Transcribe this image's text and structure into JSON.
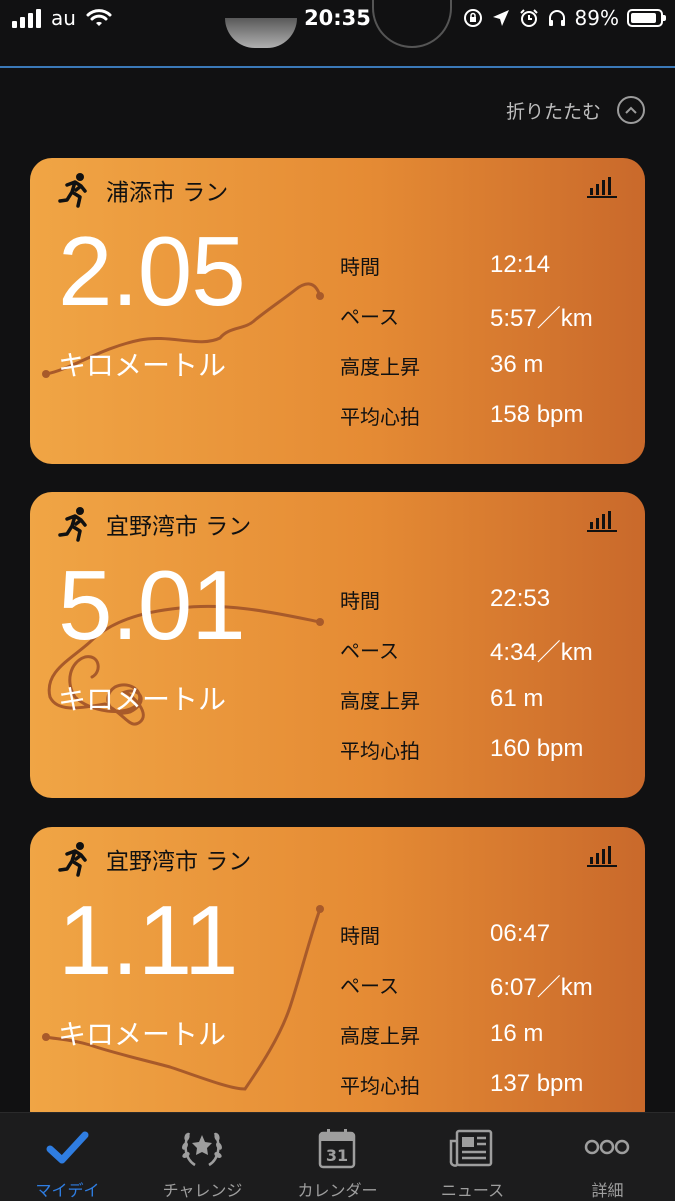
{
  "status_bar": {
    "carrier": "au",
    "time": "20:35",
    "battery_percent": "89%",
    "battery_level": 0.89
  },
  "collapse": {
    "label": "折りたたむ"
  },
  "activities": [
    {
      "title": "浦添市 ラン",
      "distance": "2.05",
      "unit": "キロメートル",
      "metrics": [
        {
          "label": "時間",
          "value": "12:14"
        },
        {
          "label": "ペース",
          "value": "5:57／km"
        },
        {
          "label": "高度上昇",
          "value": "36 m"
        },
        {
          "label": "平均心拍",
          "value": "158 bpm"
        }
      ]
    },
    {
      "title": "宜野湾市 ラン",
      "distance": "5.01",
      "unit": "キロメートル",
      "metrics": [
        {
          "label": "時間",
          "value": "22:53"
        },
        {
          "label": "ペース",
          "value": "4:34／km"
        },
        {
          "label": "高度上昇",
          "value": "61 m"
        },
        {
          "label": "平均心拍",
          "value": "160 bpm"
        }
      ]
    },
    {
      "title": "宜野湾市 ラン",
      "distance": "1.11",
      "unit": "キロメートル",
      "metrics": [
        {
          "label": "時間",
          "value": "06:47"
        },
        {
          "label": "ペース",
          "value": "6:07／km"
        },
        {
          "label": "高度上昇",
          "value": "16 m"
        },
        {
          "label": "平均心拍",
          "value": "137 bpm"
        }
      ]
    }
  ],
  "tabs": [
    {
      "label": "マイデイ",
      "icon": "checkmark-icon",
      "active": true
    },
    {
      "label": "チャレンジ",
      "icon": "laurel-icon",
      "active": false
    },
    {
      "label": "カレンダー",
      "icon": "calendar-icon",
      "day": "31",
      "active": false
    },
    {
      "label": "ニュース",
      "icon": "newspaper-icon",
      "active": false
    },
    {
      "label": "詳細",
      "icon": "more-icon",
      "active": false
    }
  ],
  "colors": {
    "background": "#111112",
    "accent": "#2f7de1",
    "card_start": "#f0a545",
    "card_end": "#c9692b",
    "route": "#a85a2a"
  }
}
